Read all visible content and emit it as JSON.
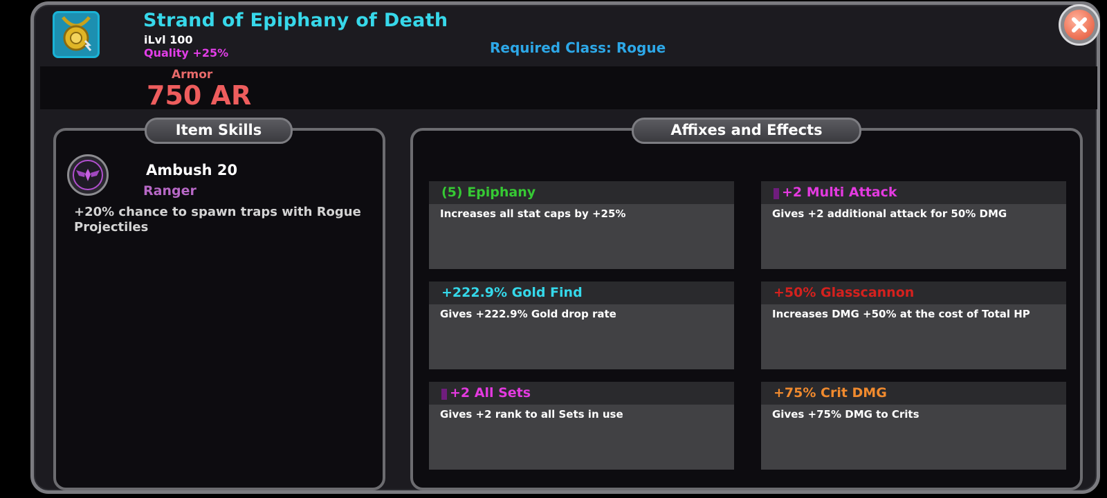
{
  "item": {
    "icon": "gold-amulet-icon",
    "name": "Strand of Epiphany of Death",
    "ilvl": "iLvl 100",
    "quality": "Quality  +25%",
    "required_class": "Required Class: Rogue",
    "armor_label": "Armor",
    "armor_value": "750 AR"
  },
  "close_icon": "close-icon",
  "item_skills": {
    "tab_label": "Item Skills",
    "skill": {
      "icon": "winged-emblem-icon",
      "name": "Ambush 20",
      "class": "Ranger",
      "description": "+20% chance to spawn traps with Rogue Projectiles"
    }
  },
  "affixes": {
    "tab_label": "Affixes and Effects",
    "items": [
      {
        "title": "(5) Epiphany",
        "color": "#36c934",
        "gem": false,
        "desc": "Increases all stat caps by +25%"
      },
      {
        "title": "+2 Multi Attack",
        "color": "#e43ae0",
        "gem": true,
        "desc": "Gives +2 additional attack for 50% DMG"
      },
      {
        "title": "+222.9% Gold Find",
        "color": "#35d8ea",
        "gem": false,
        "desc": "Gives +222.9% Gold drop rate"
      },
      {
        "title": "+50% Glasscannon",
        "color": "#d4211e",
        "gem": false,
        "desc": "Increases DMG +50% at the cost of Total HP"
      },
      {
        "title": "+2 All Sets",
        "color": "#e43ae0",
        "gem": true,
        "desc": "Gives +2 rank to all Sets in use"
      },
      {
        "title": "+75% Crit DMG",
        "color": "#f08a2e",
        "gem": false,
        "desc": "Gives +75% DMG to Crits"
      }
    ]
  }
}
